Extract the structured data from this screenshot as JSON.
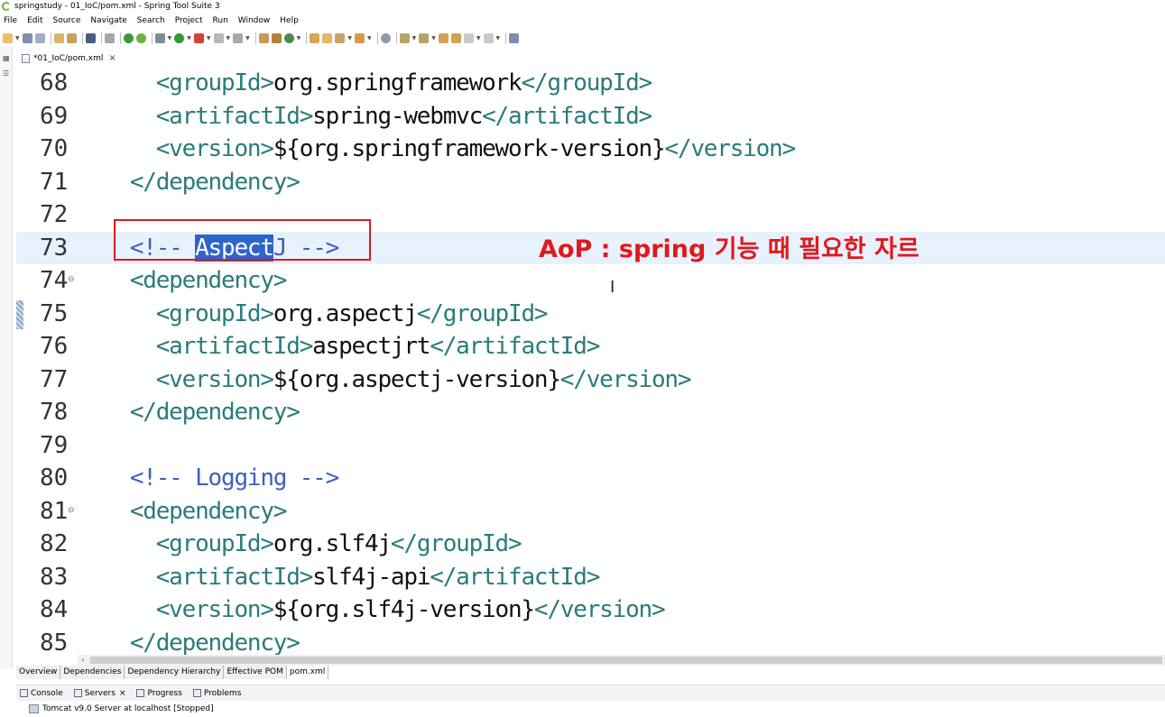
{
  "window": {
    "title": "springstudy - 01_IoC/pom.xml - Spring Tool Suite 3"
  },
  "menu": [
    "File",
    "Edit",
    "Source",
    "Navigate",
    "Search",
    "Project",
    "Run",
    "Window",
    "Help"
  ],
  "editor_tab": {
    "label": "*01_IoC/pom.xml",
    "close": "×"
  },
  "code_lines": [
    {
      "num": "68",
      "parts": [
        [
          "tag",
          "      <groupId>"
        ],
        [
          "txt",
          "org.springframework"
        ],
        [
          "tag",
          "</groupId>"
        ]
      ]
    },
    {
      "num": "69",
      "parts": [
        [
          "tag",
          "      <artifactId>"
        ],
        [
          "txt",
          "spring-webmvc"
        ],
        [
          "tag",
          "</artifactId>"
        ]
      ]
    },
    {
      "num": "70",
      "parts": [
        [
          "tag",
          "      <version>"
        ],
        [
          "txt",
          "${org.springframework-version}"
        ],
        [
          "tag",
          "</version>"
        ]
      ]
    },
    {
      "num": "71",
      "parts": [
        [
          "tag",
          "    </dependency>"
        ]
      ]
    },
    {
      "num": "72",
      "parts": []
    },
    {
      "num": "73",
      "current": true,
      "parts": [
        [
          "cmt",
          "    <!-- "
        ],
        [
          "sel",
          "Aspect"
        ],
        [
          "cmt",
          "J -->"
        ]
      ]
    },
    {
      "num": "74",
      "fold": true,
      "parts": [
        [
          "tag",
          "    <dependency>"
        ]
      ]
    },
    {
      "num": "75",
      "parts": [
        [
          "tag",
          "      <groupId>"
        ],
        [
          "txt",
          "org.aspectj"
        ],
        [
          "tag",
          "</groupId>"
        ]
      ]
    },
    {
      "num": "76",
      "parts": [
        [
          "tag",
          "      <artifactId>"
        ],
        [
          "txt",
          "aspectjrt"
        ],
        [
          "tag",
          "</artifactId>"
        ]
      ]
    },
    {
      "num": "77",
      "parts": [
        [
          "tag",
          "      <version>"
        ],
        [
          "txt",
          "${org.aspectj-version}"
        ],
        [
          "tag",
          "</version>"
        ]
      ]
    },
    {
      "num": "78",
      "parts": [
        [
          "tag",
          "    </dependency>"
        ]
      ]
    },
    {
      "num": "79",
      "parts": []
    },
    {
      "num": "80",
      "parts": [
        [
          "cmt",
          "    <!-- Logging -->"
        ]
      ]
    },
    {
      "num": "81",
      "fold": true,
      "parts": [
        [
          "tag",
          "    <dependency>"
        ]
      ]
    },
    {
      "num": "82",
      "parts": [
        [
          "tag",
          "      <groupId>"
        ],
        [
          "txt",
          "org.slf4j"
        ],
        [
          "tag",
          "</groupId>"
        ]
      ]
    },
    {
      "num": "83",
      "parts": [
        [
          "tag",
          "      <artifactId>"
        ],
        [
          "txt",
          "slf4j-api"
        ],
        [
          "tag",
          "</artifactId>"
        ]
      ]
    },
    {
      "num": "84",
      "parts": [
        [
          "tag",
          "      <version>"
        ],
        [
          "txt",
          "${org.slf4j-version}"
        ],
        [
          "tag",
          "</version>"
        ]
      ]
    },
    {
      "num": "85",
      "parts": [
        [
          "tag",
          "    </dependency>"
        ]
      ]
    }
  ],
  "annotation": {
    "text": "AoP : spring 기능 때 필요한 자르",
    "color": "#e0191c"
  },
  "pom_tabs": [
    "Overview",
    "Dependencies",
    "Dependency Hierarchy",
    "Effective POM",
    "pom.xml"
  ],
  "pom_active_tab": "pom.xml",
  "bottom_tabs": [
    {
      "label": "Console",
      "close": false
    },
    {
      "label": "Servers",
      "close": true
    },
    {
      "label": "Progress",
      "close": false
    },
    {
      "label": "Problems",
      "close": false
    }
  ],
  "server_entry": "Tomcat v9.0 Server at localhost  [Stopped]",
  "colors": {
    "tag": "#2b7b7b",
    "comment": "#3f5fbf",
    "selection": "#2f65ca",
    "current_line": "#e8f2fe"
  }
}
